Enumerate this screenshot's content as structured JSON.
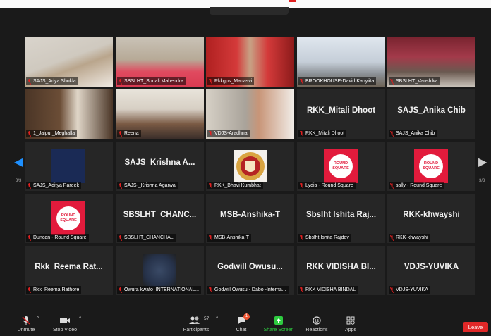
{
  "grid": {
    "tiles": [
      {
        "label": "SAJS_Adya Shukla",
        "big": "",
        "video": "adya"
      },
      {
        "label": "SBSLHT_Sonali Mahendra",
        "big": "",
        "video": "sonali"
      },
      {
        "label": "Rkkgps_Manasvi",
        "big": "",
        "video": "manasvi"
      },
      {
        "label": "BROOKHOUSE-David Kanyiita",
        "big": "",
        "video": "david"
      },
      {
        "label": "SBSLHT_Vanshika",
        "big": "",
        "video": "vanshika"
      },
      {
        "label": "1_Jaipur_Meghalla",
        "big": "",
        "video": "meghalla"
      },
      {
        "label": "Reena",
        "big": "",
        "video": "reena"
      },
      {
        "label": "VDJS-Aradhna",
        "big": "",
        "video": "aradhna"
      },
      {
        "label": "RKK_Mitali Dhoot",
        "big": "RKK_Mitali Dhoot",
        "video": ""
      },
      {
        "label": "SAJS_Anika Chib",
        "big": "SAJS_Anika Chib",
        "video": ""
      },
      {
        "label": "SAJS_Aditya Pareek",
        "big": "",
        "video": "aditya"
      },
      {
        "label": "SAJS-_Krishna Agarwal",
        "big": "SAJS_Krishna A...",
        "video": ""
      },
      {
        "label": "RKK_Bhavi Kumbhat",
        "big": "",
        "video": "emblem"
      },
      {
        "label": "Lydia - Round Square",
        "big": "",
        "video": "roundsquare"
      },
      {
        "label": "sally - Round Square",
        "big": "",
        "video": "roundsquare"
      },
      {
        "label": "Duncan - Round Square",
        "big": "",
        "video": "roundsquare"
      },
      {
        "label": "SBSLHT_CHANCHAL",
        "big": "SBSLHT_CHANC...",
        "video": ""
      },
      {
        "label": "MSB-Anshika-T",
        "big": "MSB-Anshika-T",
        "video": ""
      },
      {
        "label": "Sbslht Ishita Rajdev",
        "big": "Sbslht Ishita Raj...",
        "video": ""
      },
      {
        "label": "RKK-khwayshi",
        "big": "RKK-khwayshi",
        "video": ""
      },
      {
        "label": "Rkk_Reema Rathore",
        "big": "Rkk_Reema Rat...",
        "video": ""
      },
      {
        "label": "Owura kwafo_INTERNATIONAL...",
        "big": "",
        "video": "owura"
      },
      {
        "label": "Godwill Owusu - Dabo -Interna...",
        "big": "Godwill Owusu...",
        "video": ""
      },
      {
        "label": "RKK VIDISHA BINDAL",
        "big": "RKK VIDISHA BI...",
        "video": ""
      },
      {
        "label": "VDJS-YUVIKA",
        "big": "VDJS-YUVIKA",
        "video": ""
      }
    ],
    "round_square_text": "ROUND SQUARE"
  },
  "pager": {
    "left": "3/3",
    "right": "3/3"
  },
  "toolbar": {
    "unmute": "Unmute",
    "stop_video": "Stop Video",
    "participants": "Participants",
    "participants_count": "57",
    "chat": "Chat",
    "chat_badge": "1",
    "share_screen": "Share Screen",
    "reactions": "Reactions",
    "apps": "Apps",
    "leave": "Leave"
  },
  "colors": {
    "accent_share": "#2ecc40",
    "leave": "#e02828",
    "mic_muted": "#e02020",
    "round_square": "#e21b3c"
  }
}
